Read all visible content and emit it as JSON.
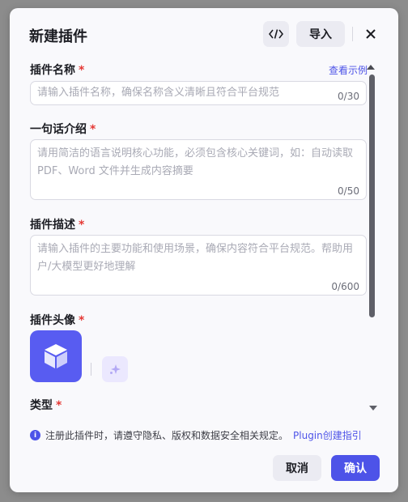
{
  "dialog": {
    "title": "新建插件",
    "import_label": "导入",
    "icons": {
      "code": "code-icon",
      "close": "close-icon"
    }
  },
  "fields": {
    "name": {
      "label": "插件名称",
      "required_mark": "*",
      "example_link": "查看示例",
      "placeholder": "请输入插件名称，确保名称含义清晰且符合平台规范",
      "count": "0/30"
    },
    "intro": {
      "label": "一句话介绍",
      "required_mark": "*",
      "placeholder": "请用简洁的语言说明核心功能，必须包含核心关键词，如：自动读取 PDF、Word 文件并生成内容摘要",
      "count": "0/50"
    },
    "description": {
      "label": "插件描述",
      "required_mark": "*",
      "placeholder": "请输入插件的主要功能和使用场景，确保内容符合平台规范。帮助用户/大模型更好地理解",
      "count": "0/600"
    },
    "avatar": {
      "label": "插件头像",
      "required_mark": "*",
      "icons": {
        "avatar": "cube-icon",
        "generate": "sparkle-icon"
      }
    },
    "type": {
      "label": "类型",
      "required_mark": "*"
    }
  },
  "notice": {
    "text": "注册此插件时，请遵守隐私、版权和数据安全相关规定。",
    "link": "Plugin创建指引"
  },
  "footer": {
    "cancel_label": "取消",
    "confirm_label": "确认"
  },
  "colors": {
    "accent": "#4d53e8",
    "avatar_bg": "#585cf1",
    "required": "#e53935"
  }
}
